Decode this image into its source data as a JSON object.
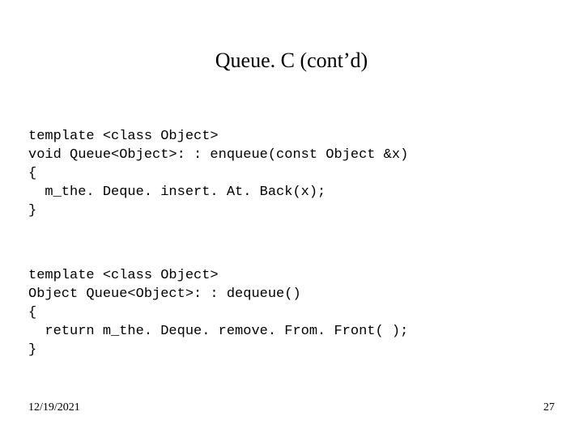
{
  "title": "Queue. C (cont’d)",
  "code_block_1": "template <class Object>\nvoid Queue<Object>: : enqueue(const Object &x)\n{\n  m_the. Deque. insert. At. Back(x);\n}",
  "code_block_2": "template <class Object>\nObject Queue<Object>: : dequeue()\n{\n  return m_the. Deque. remove. From. Front( );\n}",
  "footer": {
    "date": "12/19/2021",
    "page": "27"
  }
}
